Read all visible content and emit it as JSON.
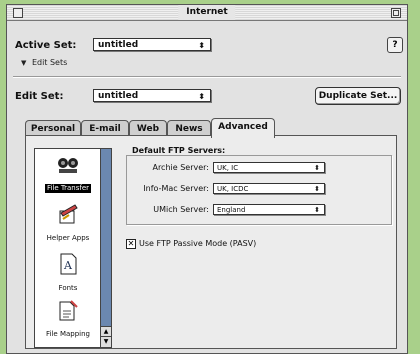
{
  "window": {
    "title": "Internet"
  },
  "active_set": {
    "label": "Active Set:",
    "value": "untitled"
  },
  "edit_sets_disclosure": {
    "label": "Edit Sets"
  },
  "edit_set": {
    "label": "Edit Set:",
    "value": "untitled",
    "duplicate_label": "Duplicate Set..."
  },
  "help": {
    "label": "?"
  },
  "tabs": [
    {
      "label": "Personal"
    },
    {
      "label": "E-mail"
    },
    {
      "label": "Web"
    },
    {
      "label": "News"
    },
    {
      "label": "Advanced"
    }
  ],
  "sidebar": {
    "items": [
      {
        "label": "File Transfer",
        "icon": "file-transfer-icon"
      },
      {
        "label": "Helper Apps",
        "icon": "helper-apps-icon"
      },
      {
        "label": "Fonts",
        "icon": "fonts-icon"
      },
      {
        "label": "File Mapping",
        "icon": "file-mapping-icon"
      }
    ]
  },
  "ftp": {
    "section_title": "Default FTP Servers:",
    "archie": {
      "label": "Archie Server:",
      "value": "UK, IC"
    },
    "infomac": {
      "label": "Info-Mac Server:",
      "value": "UK, ICDC"
    },
    "umich": {
      "label": "UMich Server:",
      "value": "England"
    },
    "passive": {
      "label": "Use FTP Passive Mode (PASV)",
      "checked_mark": "✕"
    }
  },
  "arrows": "⬍",
  "colors": {
    "background": "#a9d08a",
    "scrollbar": "#6b88b0"
  }
}
